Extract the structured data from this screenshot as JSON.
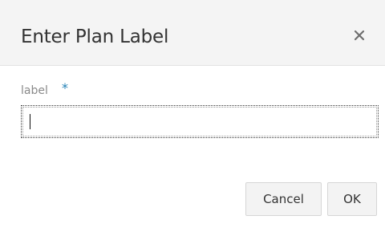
{
  "dialog": {
    "title": "Enter Plan Label",
    "close_icon": "close-icon"
  },
  "form": {
    "label": "label",
    "required_marker": "*",
    "input_value": ""
  },
  "actions": {
    "cancel_label": "Cancel",
    "ok_label": "OK"
  },
  "colors": {
    "header_bg": "#f4f4f4",
    "required_star": "#1f7fb5",
    "button_bg": "#f3f3f3"
  }
}
